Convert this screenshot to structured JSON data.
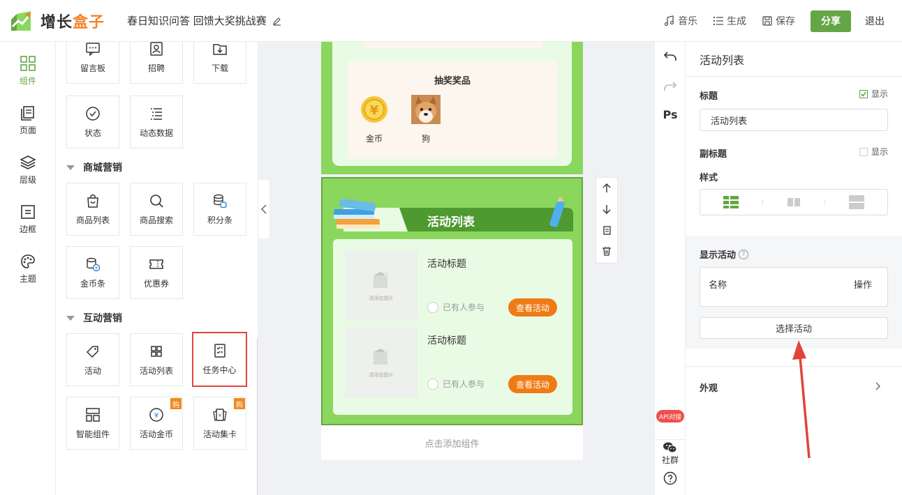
{
  "header": {
    "logo_main": "增长",
    "logo_accent": "盒子",
    "doc_title": "春日知识问答 回馈大奖挑战赛",
    "music_label": "音乐",
    "generate_label": "生成",
    "save_label": "保存",
    "share_label": "分享",
    "exit_label": "退出"
  },
  "rail": {
    "items": [
      {
        "label": "组件",
        "icon": "grid-icon",
        "active": true
      },
      {
        "label": "页面",
        "icon": "pages-icon"
      },
      {
        "label": "层级",
        "icon": "layers-icon"
      },
      {
        "label": "边框",
        "icon": "border-icon"
      },
      {
        "label": "主题",
        "icon": "palette-icon"
      }
    ]
  },
  "components": {
    "top_tiles": [
      "留言板",
      "招聘",
      "下载",
      "状态",
      "动态数据"
    ],
    "mall_section": "商城营销",
    "mall_tiles": [
      "商品列表",
      "商品搜索",
      "积分条",
      "金币条",
      "优惠券"
    ],
    "interactive_section": "互动营销",
    "interactive_tiles": [
      "活动",
      "活动列表",
      "任务中心",
      "智能组件",
      "活动金币",
      "活动集卡"
    ],
    "buy_badge": "购"
  },
  "phone": {
    "prize_title": "抽奖奖品",
    "prizes": [
      {
        "name": "金币",
        "icon": "gold-coin-icon"
      },
      {
        "name": "狗",
        "icon": "shiba-dog-image"
      }
    ],
    "activity_list_title": "活动列表",
    "activities": [
      {
        "title": "活动标题",
        "placeholder": "请添加图片",
        "joined": "已有人参与",
        "button": "查看活动"
      },
      {
        "title": "活动标题",
        "placeholder": "请添加图片",
        "joined": "已有人参与",
        "button": "查看活动"
      }
    ],
    "add_component": "点击添加组件"
  },
  "tool_strip": {
    "ps_label": "Ps",
    "api_label": "API对接",
    "community_label": "社群"
  },
  "settings": {
    "panel_title": "活动列表",
    "title_label": "标题",
    "title_show": "显示",
    "title_show_checked": true,
    "title_value": "活动列表",
    "subtitle_label": "副标题",
    "subtitle_show": "显示",
    "subtitle_show_checked": false,
    "style_label": "样式",
    "show_activity_label": "显示活动",
    "col_name": "名称",
    "col_action": "操作",
    "choose_button": "选择活动",
    "appearance_label": "外观"
  },
  "colors": {
    "brand_green": "#64a545",
    "canvas_green": "#8bd75e",
    "orange": "#f07b15",
    "highlight_red": "#e0443a"
  }
}
